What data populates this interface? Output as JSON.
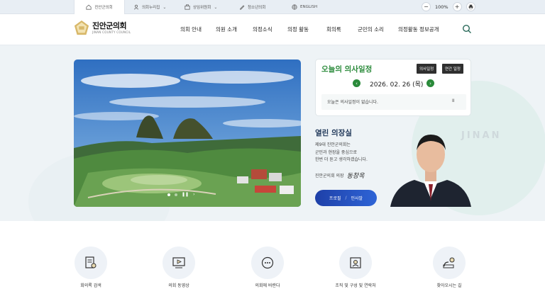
{
  "topbar": {
    "tabs": [
      {
        "label": "진안군의회",
        "icon": "home-icon",
        "active": true
      },
      {
        "label": "의회누리집",
        "icon": "user-icon",
        "dropdown": true
      },
      {
        "label": "상임위원회",
        "icon": "group-icon",
        "dropdown": true
      },
      {
        "label": "청소년의회",
        "icon": "pen-icon"
      },
      {
        "label": "ENGLISH",
        "icon": "globe-icon"
      }
    ],
    "zoom": "100%"
  },
  "header": {
    "logo_ko": "진안군의회",
    "logo_en": "JINAN COUNTY COUNCIL",
    "nav": [
      "의회 안내",
      "의원 소개",
      "의정소식",
      "의정 활동",
      "회의록",
      "군민의 소리",
      "의정활동 정보공개"
    ]
  },
  "hero": {
    "watermark": "JINAN"
  },
  "schedule": {
    "title": "오늘의 의사일정",
    "btn_schedule": "의사일정",
    "btn_annual": "연간 일정",
    "date": "2026. 02. 26 (목)",
    "empty_msg": "오늘은 의사일정이 없습니다.",
    "pause": "II"
  },
  "speaker": {
    "title": "열린 의장실",
    "lines": [
      "제9대 진안군의회는",
      "군민과 현장을 중심으로",
      "한번 더 듣고 생각하겠습니다."
    ],
    "sign_label": "진안군의회 의장",
    "signature": "동창옥",
    "btn_profile": "프로필",
    "btn_sep": "/",
    "btn_greeting": "인사말"
  },
  "quick_menu": [
    {
      "label": "회의록 검색",
      "icon": "document-search-icon"
    },
    {
      "label": "의회 동영상",
      "icon": "video-icon"
    },
    {
      "label": "의회에 바란다",
      "icon": "chat-icon"
    },
    {
      "label": "조직 및 구성 및 연락처",
      "icon": "organization-icon"
    },
    {
      "label": "찾아오시는 길",
      "icon": "map-icon"
    }
  ],
  "colors": {
    "brand_green": "#2a8a3a",
    "brand_blue": "#1e40a8",
    "topbar_bg": "#e8eef4"
  }
}
